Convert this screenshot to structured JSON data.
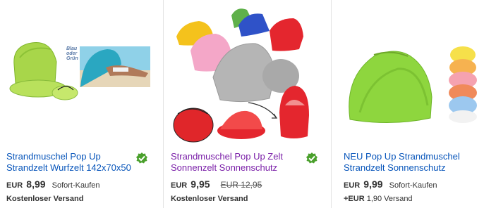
{
  "listings": [
    {
      "image_tags": [
        "Blau",
        "oder",
        "Grün"
      ],
      "title": "Strandmuschel Pop Up Strandzelt Wurfzelt 142x70x50",
      "currency": "EUR",
      "price": "8,99",
      "format": "Sofort-Kaufen",
      "old_price": "",
      "shipping_prefix": "",
      "shipping": "Kostenloser Versand",
      "badge_icon": "verified-check-icon",
      "badge_color": "#4aa02c"
    },
    {
      "image_tags": [],
      "title": "Strandmuschel Pop Up Zelt Sonnenzelt Sonnenschutz",
      "currency": "EUR",
      "price": "9,95",
      "format": "",
      "old_price": "EUR 12,95",
      "shipping_prefix": "",
      "shipping": "Kostenloser Versand",
      "badge_icon": "verified-check-icon",
      "badge_color": "#4aa02c"
    },
    {
      "image_tags": [],
      "title": "NEU Pop Up Strandmuschel Strandzelt Sonnenschutz",
      "currency": "EUR",
      "price": "9,99",
      "format": "Sofort-Kaufen",
      "old_price": "",
      "shipping_prefix": "+EUR",
      "shipping": "1,90 Versand",
      "badge_icon": "",
      "badge_color": ""
    }
  ],
  "colors": {
    "link": "#0654ba",
    "visited_link": "#7a1fa8",
    "text": "#333333"
  }
}
